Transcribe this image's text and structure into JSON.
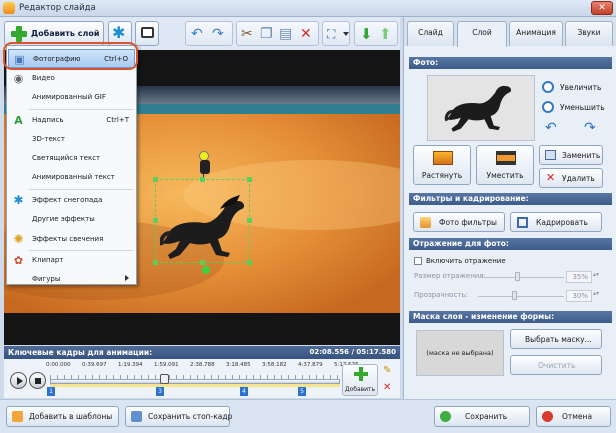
{
  "window": {
    "title": "Редактор слайда"
  },
  "toolbar": {
    "add_layer_label": "Добавить слой"
  },
  "menu": {
    "items": [
      {
        "label": "Фотографию",
        "shortcut": "Ctrl+O",
        "icon": "photo-icon",
        "highlighted": true
      },
      {
        "label": "Видео",
        "shortcut": "",
        "icon": "video-icon"
      },
      {
        "label": "Анимированный GIF",
        "shortcut": "",
        "icon": ""
      },
      {
        "label": "Надпись",
        "shortcut": "Ctrl+T",
        "icon": "text-icon"
      },
      {
        "label": "3D-текст",
        "shortcut": "",
        "icon": ""
      },
      {
        "label": "Светящийся текст",
        "shortcut": "",
        "icon": ""
      },
      {
        "label": "Анимированный текст",
        "shortcut": "",
        "icon": ""
      },
      {
        "label": "Эффект снегопада",
        "shortcut": "",
        "icon": "snowflake-icon"
      },
      {
        "label": "Другие эффекты",
        "shortcut": "",
        "icon": ""
      },
      {
        "label": "Эффекты свечения",
        "shortcut": "",
        "icon": "glow-icon"
      },
      {
        "label": "Клипарт",
        "shortcut": "",
        "icon": "clipart-icon"
      },
      {
        "label": "Фигуры",
        "shortcut": "",
        "icon": ""
      }
    ]
  },
  "keyframes": {
    "title": "Ключевые кадры для анимации:",
    "time": "02:08.556 / 05:17.580",
    "ticks": [
      "0:00.000",
      "0:39.697",
      "1:19.394",
      "1:59.091",
      "2:38.788",
      "3:18.485",
      "3:58.182",
      "4:37.879",
      "5:17.576"
    ],
    "markers": [
      "1",
      "3",
      "4",
      "5"
    ],
    "add_label": "Добавить"
  },
  "tabs": [
    "Слайд",
    "Слой",
    "Анимация",
    "Звуки"
  ],
  "active_tab": "Слой",
  "panel": {
    "photo_head": "Фото:",
    "zoom_in": "Увеличить",
    "zoom_out": "Уменьшить",
    "stretch": "Растянуть",
    "fit": "Уместить",
    "replace": "Заменить",
    "delete": "Удалить",
    "filters_head": "Фильтры и кадрирование:",
    "photo_filters": "Фото фильтры",
    "crop": "Кадрировать",
    "reflection_head": "Отражение для фото:",
    "enable_reflection": "Включить отражение",
    "reflection_size": "Размер отражения:",
    "reflection_size_val": "35%",
    "transparency": "Прозрачность:",
    "transparency_val": "30%",
    "mask_head": "Маска слоя - изменение формы:",
    "mask_preview": "(маска не выбрана)",
    "choose_mask": "Выбрать маску...",
    "clear": "Очистить"
  },
  "bottom": {
    "add_templates": "Добавить в шаблоны",
    "save_still": "Сохранить стоп-кадр",
    "save": "Сохранить",
    "cancel": "Отмена"
  }
}
